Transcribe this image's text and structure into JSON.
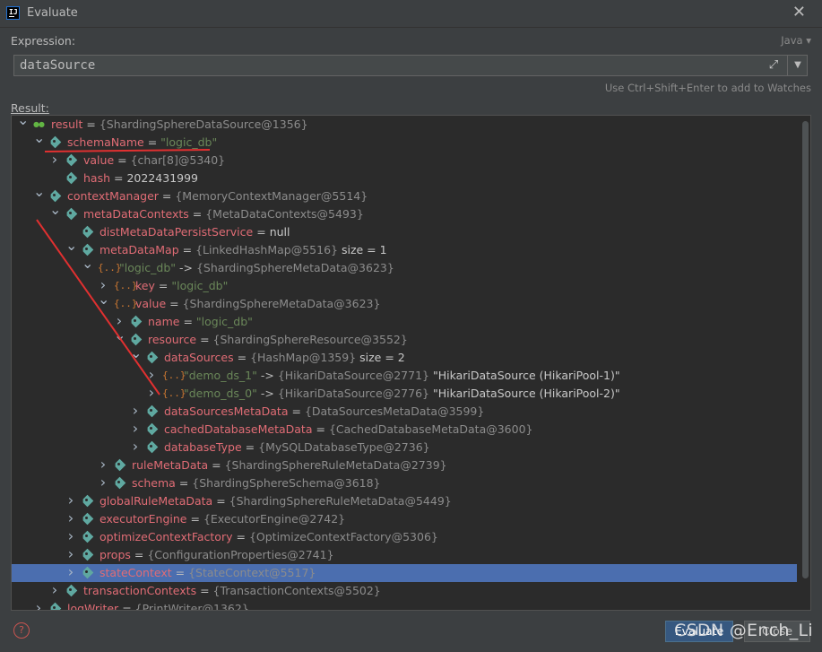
{
  "window": {
    "title": "Evaluate",
    "close_glyph": "✕",
    "app_icon_text": "IJ"
  },
  "expression": {
    "label": "Expression:",
    "language": "Java ▾",
    "value": "dataSource",
    "expand_glyph": "⤢",
    "dropdown_glyph": "▼",
    "hint": "Use Ctrl+Shift+Enter to add to Watches"
  },
  "result": {
    "label": "Result:",
    "rows": [
      {
        "arrow": "down",
        "icon": "glasses",
        "name": "result",
        "eq": "=",
        "type": "{ShardingSphereDataSource@1356}"
      },
      {
        "arrow": "down",
        "icon": "tag",
        "name": "schemaName",
        "eq": "=",
        "str": "\"logic_db\""
      },
      {
        "arrow": "right",
        "icon": "tag",
        "name": "value",
        "eq": "=",
        "type": "{char[8]@5340}"
      },
      {
        "arrow": "none",
        "icon": "tag",
        "name": "hash",
        "eq": "=",
        "plain": "2022431999"
      },
      {
        "arrow": "down",
        "icon": "tag",
        "name": "contextManager",
        "eq": "=",
        "type": "{MemoryContextManager@5514}"
      },
      {
        "arrow": "down",
        "icon": "tag",
        "name": "metaDataContexts",
        "eq": "=",
        "type": "{MetaDataContexts@5493}"
      },
      {
        "arrow": "none",
        "icon": "tag",
        "name": "distMetaDataPersistService",
        "eq": "=",
        "plain": "null"
      },
      {
        "arrow": "down",
        "icon": "tag",
        "name": "metaDataMap",
        "eq": "=",
        "type": "{LinkedHashMap@5516}",
        "extra": " size = 1"
      },
      {
        "arrow": "down",
        "icon": "map",
        "key_str": "\"logic_db\"",
        "arrow_text": "->",
        "type": "{ShardingSphereMetaData@3623}"
      },
      {
        "arrow": "right",
        "icon": "map",
        "name": "key",
        "eq": "=",
        "str": "\"logic_db\""
      },
      {
        "arrow": "down",
        "icon": "map",
        "name": "value",
        "eq": "=",
        "type": "{ShardingSphereMetaData@3623}"
      },
      {
        "arrow": "right",
        "icon": "tag",
        "name": "name",
        "eq": "=",
        "str": "\"logic_db\""
      },
      {
        "arrow": "down",
        "icon": "tag",
        "name": "resource",
        "eq": "=",
        "type": "{ShardingSphereResource@3552}"
      },
      {
        "arrow": "down",
        "icon": "tag",
        "name": "dataSources",
        "eq": "=",
        "type": "{HashMap@1359}",
        "extra": " size = 2"
      },
      {
        "arrow": "right",
        "icon": "map",
        "key_str": "\"demo_ds_1\"",
        "arrow_text": "->",
        "type": "{HikariDataSource@2771}",
        "extra": " \"HikariDataSource (HikariPool-1)\""
      },
      {
        "arrow": "right",
        "icon": "map",
        "key_str": "\"demo_ds_0\"",
        "arrow_text": "->",
        "type": "{HikariDataSource@2776}",
        "extra": " \"HikariDataSource (HikariPool-2)\""
      },
      {
        "arrow": "right",
        "icon": "tag",
        "name": "dataSourcesMetaData",
        "eq": "=",
        "type": "{DataSourcesMetaData@3599}"
      },
      {
        "arrow": "right",
        "icon": "tag",
        "name": "cachedDatabaseMetaData",
        "eq": "=",
        "type": "{CachedDatabaseMetaData@3600}"
      },
      {
        "arrow": "right",
        "icon": "tag",
        "name": "databaseType",
        "eq": "=",
        "type": "{MySQLDatabaseType@2736}"
      },
      {
        "arrow": "right",
        "icon": "tag",
        "name": "ruleMetaData",
        "eq": "=",
        "type": "{ShardingSphereRuleMetaData@2739}"
      },
      {
        "arrow": "right",
        "icon": "tag",
        "name": "schema",
        "eq": "=",
        "type": "{ShardingSphereSchema@3618}"
      },
      {
        "arrow": "right",
        "icon": "tag",
        "name": "globalRuleMetaData",
        "eq": "=",
        "type": "{ShardingSphereRuleMetaData@5449}"
      },
      {
        "arrow": "right",
        "icon": "tag",
        "name": "executorEngine",
        "eq": "=",
        "type": "{ExecutorEngine@2742}"
      },
      {
        "arrow": "right",
        "icon": "tag",
        "name": "optimizeContextFactory",
        "eq": "=",
        "type": "{OptimizeContextFactory@5306}"
      },
      {
        "arrow": "right",
        "icon": "tag",
        "name": "props",
        "eq": "=",
        "type": "{ConfigurationProperties@2741}"
      },
      {
        "arrow": "right",
        "icon": "tag",
        "name": "stateContext",
        "eq": "=",
        "type": "{StateContext@5517}",
        "selected": true
      },
      {
        "arrow": "right",
        "icon": "tag",
        "name": "transactionContexts",
        "eq": "=",
        "type": "{TransactionContexts@5502}"
      },
      {
        "arrow": "right",
        "icon": "tag",
        "name": "logWriter",
        "eq": "=",
        "type": "{PrintWriter@1362}"
      }
    ]
  },
  "footer": {
    "help_glyph": "?",
    "evaluate_label": "Evaluate",
    "close_label": "Close",
    "watermark": "CSDN @Ench_Li"
  },
  "colors": {
    "background": "#3c3f41",
    "tree_bg": "#2b2b2b",
    "field_name": "#e06c75",
    "string_value": "#6a8759",
    "type_ref": "#8c8c8c",
    "selected_row": "#4b6eaf",
    "annotation": "#e03030"
  }
}
